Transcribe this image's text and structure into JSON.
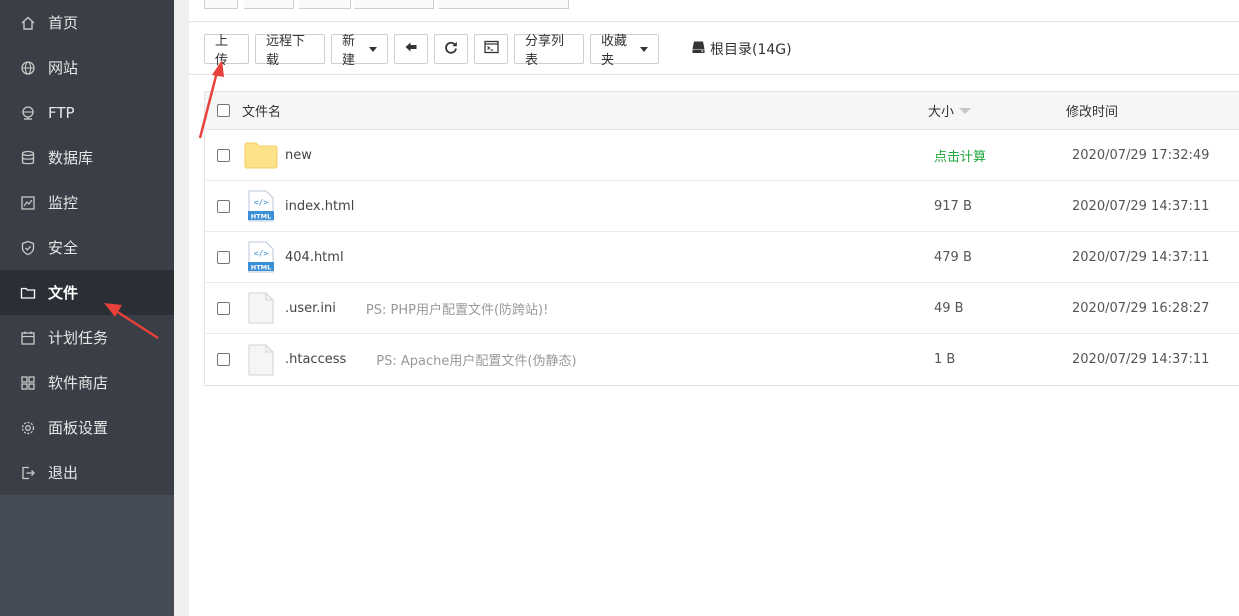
{
  "sidebar": {
    "items": [
      {
        "label": "首页",
        "icon": "home-icon",
        "active": false
      },
      {
        "label": "网站",
        "icon": "globe-icon",
        "active": false
      },
      {
        "label": "FTP",
        "icon": "ftp-icon",
        "active": false
      },
      {
        "label": "数据库",
        "icon": "database-icon",
        "active": false
      },
      {
        "label": "监控",
        "icon": "monitor-icon",
        "active": false
      },
      {
        "label": "安全",
        "icon": "shield-icon",
        "active": false
      },
      {
        "label": "文件",
        "icon": "folder-icon",
        "active": true
      },
      {
        "label": "计划任务",
        "icon": "calendar-icon",
        "active": false
      },
      {
        "label": "软件商店",
        "icon": "apps-icon",
        "active": false
      },
      {
        "label": "面板设置",
        "icon": "gear-icon",
        "active": false
      },
      {
        "label": "退出",
        "icon": "logout-icon",
        "active": false
      }
    ]
  },
  "toolbar": {
    "upload_label": "上传",
    "remote_download_label": "远程下载",
    "new_label": "新建",
    "share_list_label": "分享列表",
    "favorites_label": "收藏夹",
    "root_dir_label": "根目录(14G)"
  },
  "table": {
    "headers": {
      "name": "文件名",
      "size": "大小",
      "time": "修改时间"
    },
    "rows": [
      {
        "type": "folder",
        "name": "new",
        "note": "",
        "size": "点击计算",
        "time": "2020/07/29 17:32:49"
      },
      {
        "type": "html",
        "name": "index.html",
        "note": "",
        "size": "917 B",
        "time": "2020/07/29 14:37:11"
      },
      {
        "type": "html",
        "name": "404.html",
        "note": "",
        "size": "479 B",
        "time": "2020/07/29 14:37:11"
      },
      {
        "type": "file",
        "name": ".user.ini",
        "note": "PS: PHP用户配置文件(防跨站)!",
        "size": "49 B",
        "time": "2020/07/29 16:28:27"
      },
      {
        "type": "file",
        "name": ".htaccess",
        "note": "PS: Apache用户配置文件(伪静态)",
        "size": "1 B",
        "time": "2020/07/29 14:37:11"
      }
    ]
  },
  "html_badge": "HTML",
  "colors": {
    "sidebar": "#454c56",
    "sidebar_list": "#3a3f47",
    "active": "#2a2e35",
    "green": "#20a53a",
    "arrow": "#e8403a"
  }
}
